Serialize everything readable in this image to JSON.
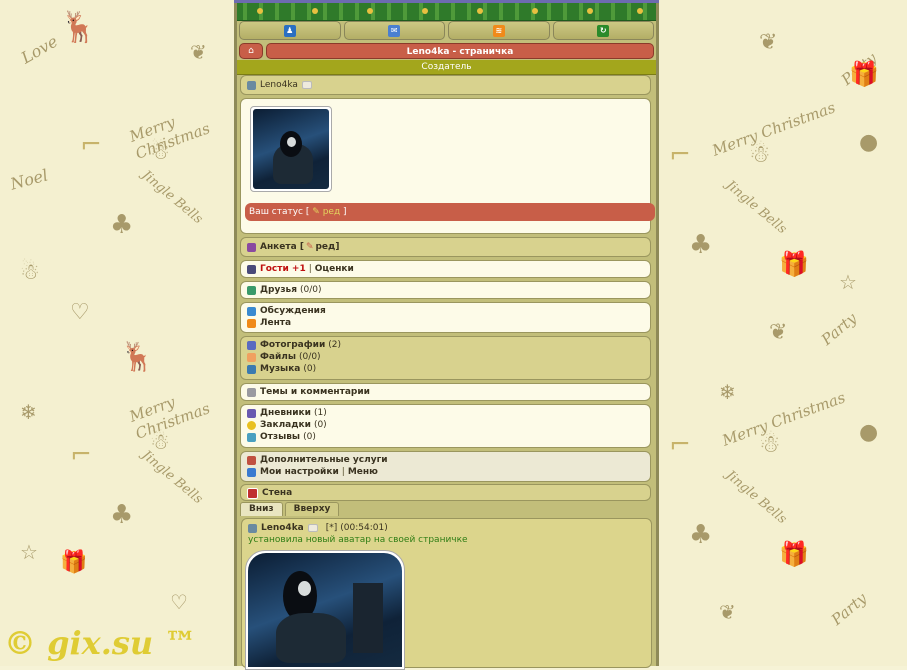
{
  "app": {
    "title": "Leno4ka - страничка",
    "creator_label": "Создатель"
  },
  "icons": {
    "profile": "user-icon",
    "mail": "envelope-icon",
    "rss": "rss-icon",
    "refresh": "refresh-icon",
    "home": "home-icon"
  },
  "colors": {
    "accent_red": "#c85e48",
    "olive": "#a3a61c",
    "panel": "#d8d28e"
  },
  "profile": {
    "username": "Leno4ka",
    "status_label": "Ваш статус [",
    "status_edit": "ред",
    "status_close": "]"
  },
  "menu": {
    "anketa": "Анкета [",
    "anketa_edit": "ред",
    "anketa_close": "]",
    "guests": "Гости +1",
    "ratings": "Оценки",
    "friends": "Друзья",
    "friends_count": "(0/0)",
    "discussions": "Обсуждения",
    "feed": "Лента",
    "photos": "Фотографии",
    "photos_count": "(2)",
    "files": "Файлы",
    "files_count": "(0/0)",
    "music": "Музыка",
    "music_count": "(0)",
    "topics": "Темы и комментарии",
    "diaries": "Дневники",
    "diaries_count": "(1)",
    "bookmarks": "Закладки",
    "bookmarks_count": "(0)",
    "reviews": "Отзывы",
    "reviews_count": "(0)",
    "services": "Дополнительные услуги",
    "settings": "Мои настройки",
    "menu_link": "Меню",
    "wall": "Стена"
  },
  "wall_tabs": {
    "down": "Вниз",
    "up": "Вверху"
  },
  "post": {
    "author": "Leno4ka",
    "marker": "[*]",
    "time": "(00:54:01)",
    "text": "установила новый аватар на своей страничке"
  },
  "background": {
    "words": [
      "Merry Christmas",
      "Jingle Bells",
      "Noel",
      "Love",
      "Party",
      "Merry Christmas",
      "Jingle Bells",
      "Party",
      "Merry Christmas",
      "Jingle Bells",
      "Party"
    ],
    "watermark": "© gix.su ™"
  }
}
